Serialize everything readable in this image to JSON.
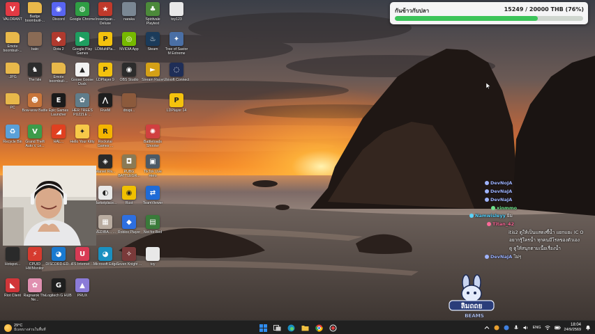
{
  "desktop_icons": [
    {
      "label": "VALORANT",
      "icon": "valorant-icon",
      "color": "#e23a44",
      "glyph": "V"
    },
    {
      "label": "Badge boombuiil-...",
      "icon": "folder-icon",
      "color": "#e8b84a",
      "glyph": ""
    },
    {
      "label": "Discord",
      "icon": "discord-icon",
      "color": "#5865f2",
      "glyph": "◉"
    },
    {
      "label": "Google Chrome",
      "icon": "chrome-icon",
      "color": "#2f9e44",
      "glyph": "◍"
    },
    {
      "label": "Insaniquar... Deluxe",
      "icon": "game-icon",
      "color": "#c0392b",
      "glyph": "★"
    },
    {
      "label": "naraka",
      "icon": "image-icon",
      "color": "#7a8793",
      "glyph": ""
    },
    {
      "label": "Spiritvale Playtest",
      "icon": "game-icon",
      "color": "#4c8a3a",
      "glyph": "♣"
    },
    {
      "label": "toy123",
      "icon": "file-icon",
      "color": "#e8e8e8",
      "glyph": ""
    },
    {
      "label": "Emote boombuil-...",
      "icon": "folder-icon",
      "color": "#e8b84a",
      "glyph": ""
    },
    {
      "label": "bato",
      "icon": "image-icon",
      "color": "#8a6b55",
      "glyph": ""
    },
    {
      "label": "Dota 2",
      "icon": "dota-icon",
      "color": "#b03a2e",
      "glyph": "◆"
    },
    {
      "label": "Google Play Games",
      "icon": "google-play-icon",
      "color": "#1e9e60",
      "glyph": "▶"
    },
    {
      "label": "LDMultiPla...",
      "icon": "ldplayer-icon",
      "color": "#f4c20d",
      "glyph": "P"
    },
    {
      "label": "NVIDIA App",
      "icon": "nvidia-icon",
      "color": "#76b900",
      "glyph": "◎"
    },
    {
      "label": "Steam",
      "icon": "steam-icon",
      "color": "#1b3b5a",
      "glyph": "♨"
    },
    {
      "label": "Tree of Savior M Extreme",
      "icon": "game-icon",
      "color": "#4a6fa5",
      "glyph": "✦"
    },
    {
      "label": ".JPG",
      "icon": "folder-icon",
      "color": "#e8b84a",
      "glyph": ""
    },
    {
      "label": "The Isle",
      "icon": "game-icon",
      "color": "#2d2d2d",
      "glyph": "♞"
    },
    {
      "label": "Emote boombuil-...",
      "icon": "folder-icon",
      "color": "#e8b84a",
      "glyph": ""
    },
    {
      "label": "Goose Goose Duck",
      "icon": "goose-icon",
      "color": "#f2f2f2",
      "glyph": "▲"
    },
    {
      "label": "LDPlayer 9",
      "icon": "ldplayer-icon",
      "color": "#f4c20d",
      "glyph": "P"
    },
    {
      "label": "OBS Studio",
      "icon": "obs-icon",
      "color": "#2c2c2c",
      "glyph": "◉"
    },
    {
      "label": "Stream Racer",
      "icon": "game-icon",
      "color": "#d4a017",
      "glyph": "►"
    },
    {
      "label": "Ubisoft Connect",
      "icon": "ubisoft-icon",
      "color": "#1f2e57",
      "glyph": "◌"
    },
    {
      "label": "PC",
      "icon": "folder-icon",
      "color": "#e8b84a",
      "glyph": ""
    },
    {
      "label": "Bow-wow Battle",
      "icon": "game-icon",
      "color": "#c8753a",
      "glyph": "☻"
    },
    {
      "label": "Epic Games Launcher",
      "icon": "epic-icon",
      "color": "#1a1a1a",
      "glyph": "E"
    },
    {
      "label": "HER TREES PUZZLE ...",
      "icon": "game-icon",
      "color": "#607d8b",
      "glyph": "✿"
    },
    {
      "label": "FiveM",
      "icon": "fivem-icon",
      "color": "#1e1e1e",
      "glyph": "⋀"
    },
    {
      "label": "dnspi...",
      "icon": "file-icon",
      "color": "#8c5a3c",
      "glyph": ""
    },
    {
      "label": "LDPlayer 14",
      "icon": "ldplayer-icon",
      "color": "#f4c20d",
      "glyph": "P"
    },
    {
      "label": "Recycle Bin",
      "icon": "recycle-bin-icon",
      "color": "#5aa0d8",
      "glyph": "♻"
    },
    {
      "label": "Grand Theft Auto V Le...",
      "icon": "gta-icon",
      "color": "#3c9b4a",
      "glyph": "V"
    },
    {
      "label": "HAL...",
      "icon": "game-icon",
      "color": "#e04020",
      "glyph": "◢"
    },
    {
      "label": "Hello Your Kitty",
      "icon": "game-icon",
      "color": "#f7c948",
      "glyph": "✦"
    },
    {
      "label": "Rockstar Games ...",
      "icon": "rockstar-icon",
      "color": "#f4b400",
      "glyph": "R"
    },
    {
      "label": "Battletoads Shooter",
      "icon": "game-icon",
      "color": "#d04040",
      "glyph": "✺"
    },
    {
      "label": "Marvel Riv...",
      "icon": "marvel-icon",
      "color": "#2a2a2a",
      "glyph": "◈"
    },
    {
      "label": "PUBG BATTLEGR...",
      "icon": "pubg-icon",
      "color": "#8a7a55",
      "glyph": "◘"
    },
    {
      "label": "TikTok Live Hero",
      "icon": "game-icon",
      "color": "#4d5a66",
      "glyph": "▣"
    },
    {
      "label": "Marketplace...",
      "icon": "game-icon",
      "color": "#e8e8e8",
      "glyph": "◐"
    },
    {
      "label": "Rust",
      "icon": "game-icon",
      "color": "#f0c000",
      "glyph": "◉"
    },
    {
      "label": "TeamViewer",
      "icon": "teamviewer-icon",
      "color": "#1f6bd6",
      "glyph": "⇄"
    },
    {
      "label": "MEDIBA... ...",
      "icon": "game-icon",
      "color": "#b9aca0",
      "glyph": "▦"
    },
    {
      "label": "Roblox Player",
      "icon": "roblox-icon",
      "color": "#2d6fe0",
      "glyph": "◆"
    },
    {
      "label": "Not for Bed",
      "icon": "game-icon",
      "color": "#3a7a3a",
      "glyph": "▤"
    },
    {
      "label": "Hotspot...",
      "icon": "file-icon",
      "color": "#2a2a2a",
      "glyph": ""
    },
    {
      "label": "CPUID HWMonitor",
      "icon": "hwmonitor-icon",
      "color": "#d63b2f",
      "glyph": "⚡"
    },
    {
      "label": "DISCORD-ED...",
      "icon": "edge-icon",
      "color": "#1a7ad0",
      "glyph": "◕"
    },
    {
      "label": "iFS Internet ...",
      "icon": "app-icon",
      "color": "#d83a54",
      "glyph": "U"
    },
    {
      "label": "Microsoft Edge",
      "icon": "edge-icon",
      "color": "#1a90c0",
      "glyph": "◕"
    },
    {
      "label": "Seven Knight ...",
      "icon": "game-icon",
      "color": "#7a3a3a",
      "glyph": "✧"
    },
    {
      "label": "toy",
      "icon": "file-icon",
      "color": "#e8e8e8",
      "glyph": ""
    },
    {
      "label": "Riot Client",
      "icon": "riot-icon",
      "color": "#d13639",
      "glyph": "◣"
    },
    {
      "label": "Ragnarok The Ne...",
      "icon": "game-icon",
      "color": "#e090b0",
      "glyph": "✿"
    },
    {
      "label": "Logitech G HUB",
      "icon": "logitech-icon",
      "color": "#1e1e1e",
      "glyph": "G"
    },
    {
      "label": "PRUX",
      "icon": "app-icon",
      "color": "#8b7bd8",
      "glyph": "▲"
    }
  ],
  "goal": {
    "title": "กันข้าวกับปลา",
    "amount_text": "15249 / 20000 THB (76%)",
    "progress": 0.76,
    "fill_color": "#3cc45a"
  },
  "chat": [
    {
      "name": "DevNoJA",
      "text": "",
      "color": "#9fb4ff"
    },
    {
      "name": "DevNaJA",
      "text": "",
      "color": "#9fb4ff"
    },
    {
      "name": "DevNaJA",
      "text": "",
      "color": "#9fb4ff"
    },
    {
      "name": "xinmmo",
      "text": "",
      "color": "#6ee08a"
    },
    {
      "name": "Namwisleyy",
      "text": "ยิม",
      "color": "#59d4ff"
    },
    {
      "name": "Titan_42",
      "text": "",
      "color": "#ff6a9a"
    },
    {
      "name": "",
      "text": "itis2 ดูให้เป็นแสดงซี้น้ำ แยกแยะ IC O",
      "color": "#ffffff"
    },
    {
      "name": "",
      "text": "อยากรู้ใครน้ำ ทุกคนมีโรลของตัวเอง",
      "color": "#ffffff"
    },
    {
      "name": "",
      "text": "ดู ดูให้สนุกตามเนื้อเรื่องน้ำ",
      "color": "#ffffff"
    },
    {
      "name": "DevNaJA",
      "text": "ไม่ๆ",
      "color": "#9fb4ff"
    }
  ],
  "logo": {
    "line1": "ลิมถถย",
    "line2": "BEAMS"
  },
  "taskbar": {
    "weather_temp": "29°C",
    "weather_desc": "มีเมฆบางส่วนในพื้นที่",
    "apps": [
      {
        "icon": "windows-start-icon",
        "color": "#2f8cf0"
      },
      {
        "icon": "task-view-icon",
        "color": "#cfcfcf"
      },
      {
        "icon": "edge-icon",
        "color": "#1a90c0"
      },
      {
        "icon": "file-explorer-icon",
        "color": "#f0c040"
      },
      {
        "icon": "chrome-icon",
        "color": "#2f9e44"
      },
      {
        "icon": "record-icon",
        "color": "#e04040"
      }
    ],
    "lang": "ENG",
    "time": "18:04",
    "date": "24/9/2569"
  }
}
